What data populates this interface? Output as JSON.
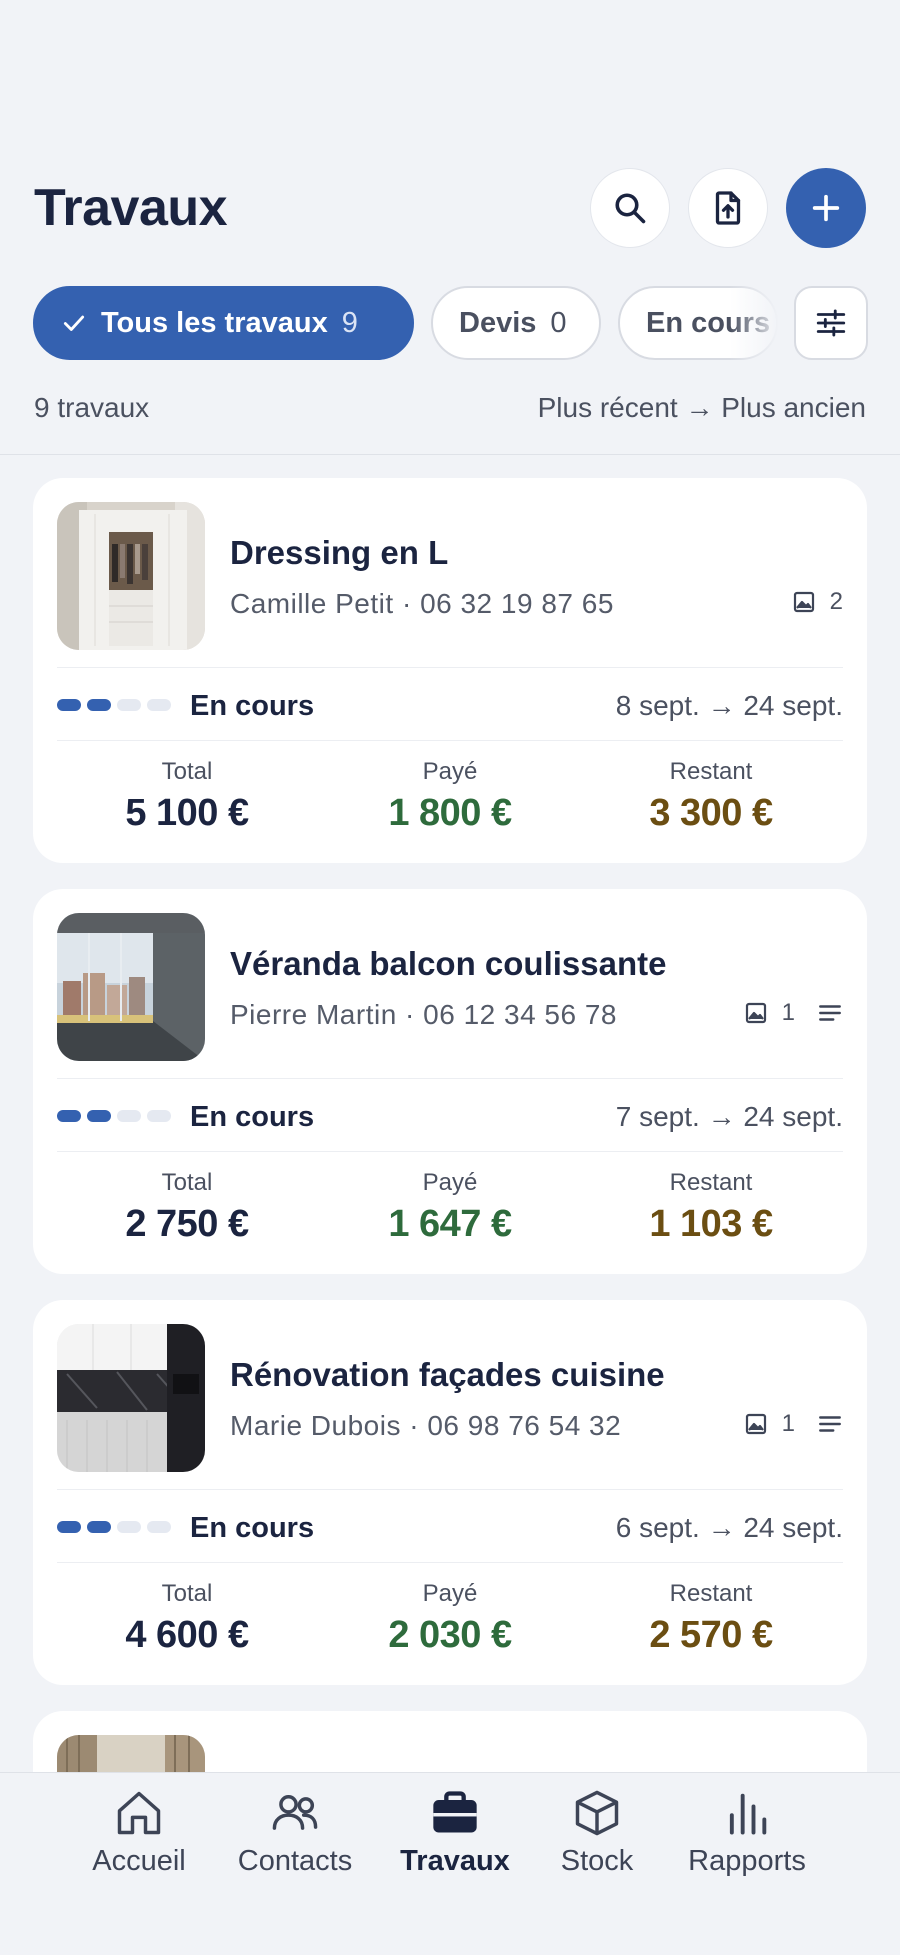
{
  "header": {
    "title": "Travaux",
    "search_icon": "search-icon",
    "export_icon": "file-upload-icon",
    "add_icon": "plus-icon"
  },
  "filters": {
    "chips": [
      {
        "label": "Tous les travaux",
        "count": "9",
        "active": true
      },
      {
        "label": "Devis",
        "count": "0",
        "active": false
      },
      {
        "label": "En cours",
        "count": "",
        "active": false
      }
    ],
    "filter_icon": "sliders-icon"
  },
  "summary": {
    "count": "9 travaux",
    "sort": "Plus récent → Plus ancien"
  },
  "cards": [
    {
      "title": "Dressing en L",
      "client": "Camille Petit",
      "phone": "06 32 19 87 65",
      "photos": "2",
      "has_notes": false,
      "status": "En cours",
      "progress": 2,
      "progress_total": 4,
      "dates": "8 sept. → 24 sept.",
      "total_label": "Total",
      "total": "5 100 €",
      "paid_label": "Payé",
      "paid": "1 800 €",
      "remaining_label": "Restant",
      "remaining": "3 300 €"
    },
    {
      "title": "Véranda balcon coulissante",
      "client": "Pierre Martin",
      "phone": "06 12 34 56 78",
      "photos": "1",
      "has_notes": true,
      "status": "En cours",
      "progress": 2,
      "progress_total": 4,
      "dates": "7 sept. → 24 sept.",
      "total_label": "Total",
      "total": "2 750 €",
      "paid_label": "Payé",
      "paid": "1 647 €",
      "remaining_label": "Restant",
      "remaining": "1 103 €"
    },
    {
      "title": "Rénovation façades cuisine",
      "client": "Marie Dubois",
      "phone": "06 98 76 54 32",
      "photos": "1",
      "has_notes": true,
      "status": "En cours",
      "progress": 2,
      "progress_total": 4,
      "dates": "6 sept. → 24 sept.",
      "total_label": "Total",
      "total": "4 600 €",
      "paid_label": "Payé",
      "paid": "2 030 €",
      "remaining_label": "Restant",
      "remaining": "2 570 €"
    }
  ],
  "nav": [
    {
      "label": "Accueil",
      "icon": "home-icon",
      "active": false
    },
    {
      "label": "Contacts",
      "icon": "users-icon",
      "active": false
    },
    {
      "label": "Travaux",
      "icon": "briefcase-icon",
      "active": true
    },
    {
      "label": "Stock",
      "icon": "box-icon",
      "active": false
    },
    {
      "label": "Rapports",
      "icon": "bar-chart-icon",
      "active": false
    }
  ],
  "colors": {
    "accent": "#3461b0",
    "paid": "#2e6b3c",
    "remaining": "#6b4e12",
    "text": "#1b2440"
  }
}
